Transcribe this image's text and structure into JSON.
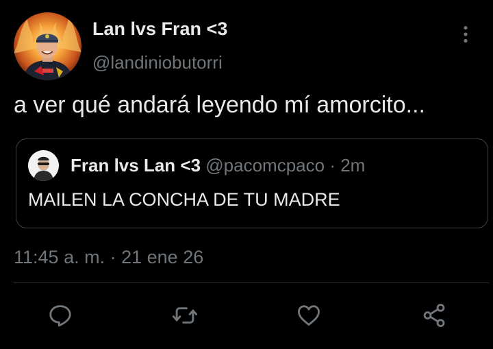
{
  "tweet": {
    "author": {
      "display_name": "Lan lvs Fran <3",
      "handle": "@landiniobutorri"
    },
    "text": "a ver qué andará leyendo mí amorcito...",
    "quote": {
      "display_name": "Fran lvs Lan <3",
      "handle": "@pacomcpaco",
      "separator": "·",
      "time_ago": "2m",
      "text": "MAILEN LA CONCHA DE TU MADRE"
    },
    "meta": {
      "time": "11:45 a. m.",
      "separator": "·",
      "date": "21 ene 26"
    }
  },
  "icons": {
    "more": "more-vertical-icon",
    "reply": "reply-icon",
    "retweet": "retweet-icon",
    "like": "heart-icon",
    "share": "share-icon"
  },
  "colors": {
    "background": "#000000",
    "text_primary": "#e7e9ea",
    "text_secondary": "#71767b",
    "border": "#3e4144",
    "divider": "#2f3336"
  }
}
